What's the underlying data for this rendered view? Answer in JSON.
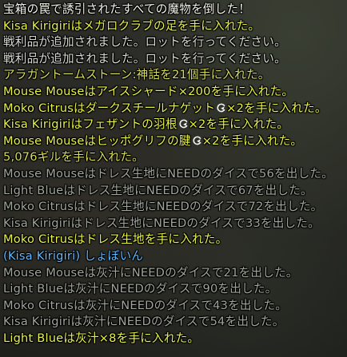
{
  "colors": {
    "system": "#f2f2ea",
    "player": "#e6f04a",
    "loot_info": "#d9d9d0",
    "currency": "#d8dc5a",
    "roll": "#9fa59a",
    "party_chat": "#5fb8ff"
  },
  "lines": [
    {
      "segments": [
        {
          "text": "宝箱の罠で誘引されたすべての魔物を倒した！",
          "color": "system"
        }
      ]
    },
    {
      "segments": [
        {
          "text": "Kisa Kirigiri",
          "color": "player"
        },
        {
          "text": "はメガロクラブの足を手に入れた。",
          "color": "player"
        }
      ]
    },
    {
      "segments": [
        {
          "text": "戦利品が追加されました。ロットを行ってください。",
          "color": "loot_info"
        }
      ]
    },
    {
      "segments": [
        {
          "text": "戦利品が追加されました。ロットを行ってください。",
          "color": "loot_info"
        }
      ]
    },
    {
      "segments": [
        {
          "text": "アラガントームストーン:神話を21個手に入れた。",
          "color": "currency"
        }
      ]
    },
    {
      "segments": [
        {
          "text": "Mouse Mouse",
          "color": "player"
        },
        {
          "text": "はアイスシャード×200を手に入れた。",
          "color": "player"
        }
      ]
    },
    {
      "segments": [
        {
          "text": "Moko Citrus",
          "color": "player"
        },
        {
          "text": "はダークスチールナゲット",
          "color": "player"
        },
        {
          "icon": "hq-icon"
        },
        {
          "text": "×2を手に入れた。",
          "color": "player"
        }
      ]
    },
    {
      "segments": [
        {
          "text": "Kisa Kirigiri",
          "color": "player"
        },
        {
          "text": "はフェザントの羽根",
          "color": "player"
        },
        {
          "icon": "hq-icon"
        },
        {
          "text": "×2を手に入れた。",
          "color": "player"
        }
      ]
    },
    {
      "segments": [
        {
          "text": "Mouse Mouse",
          "color": "player"
        },
        {
          "text": "はヒッポグリフの腱",
          "color": "player"
        },
        {
          "icon": "hq-icon"
        },
        {
          "text": "×2を手に入れた。",
          "color": "player"
        }
      ]
    },
    {
      "segments": [
        {
          "text": "5,076ギルを手に入れた。",
          "color": "currency"
        }
      ]
    },
    {
      "segments": [
        {
          "text": "Mouse Mouse",
          "color": "roll"
        },
        {
          "text": "はドレス生地にNEEDのダイスで56を出した。",
          "color": "roll"
        }
      ]
    },
    {
      "segments": [
        {
          "text": "Light Blue",
          "color": "roll"
        },
        {
          "text": "はドレス生地にNEEDのダイスで67を出した。",
          "color": "roll"
        }
      ]
    },
    {
      "segments": [
        {
          "text": "Moko Citrus",
          "color": "roll"
        },
        {
          "text": "はドレス生地にNEEDのダイスで72を出した。",
          "color": "roll"
        }
      ]
    },
    {
      "segments": [
        {
          "text": "Kisa Kirigiri",
          "color": "roll"
        },
        {
          "text": "はドレス生地にNEEDのダイスで33を出した。",
          "color": "roll"
        }
      ]
    },
    {
      "segments": [
        {
          "text": "Moko Citrus",
          "color": "player"
        },
        {
          "text": "はドレス生地を手に入れた。",
          "color": "player"
        }
      ]
    },
    {
      "segments": [
        {
          "text": "(Kisa Kirigiri) しょぼいん",
          "color": "party_chat"
        }
      ]
    },
    {
      "segments": [
        {
          "text": "Mouse Mouse",
          "color": "roll"
        },
        {
          "text": "は灰汁にNEEDのダイスで21を出した。",
          "color": "roll"
        }
      ]
    },
    {
      "segments": [
        {
          "text": "Light Blue",
          "color": "roll"
        },
        {
          "text": "は灰汁にNEEDのダイスで90を出した。",
          "color": "roll"
        }
      ]
    },
    {
      "segments": [
        {
          "text": "Moko Citrus",
          "color": "roll"
        },
        {
          "text": "は灰汁にNEEDのダイスで43を出した。",
          "color": "roll"
        }
      ]
    },
    {
      "segments": [
        {
          "text": "Kisa Kirigiri",
          "color": "roll"
        },
        {
          "text": "は灰汁にNEEDのダイスで54を出した。",
          "color": "roll"
        }
      ]
    },
    {
      "segments": [
        {
          "text": "Light Blue",
          "color": "player"
        },
        {
          "text": "は灰汁×8を手に入れた。",
          "color": "player"
        }
      ]
    }
  ]
}
